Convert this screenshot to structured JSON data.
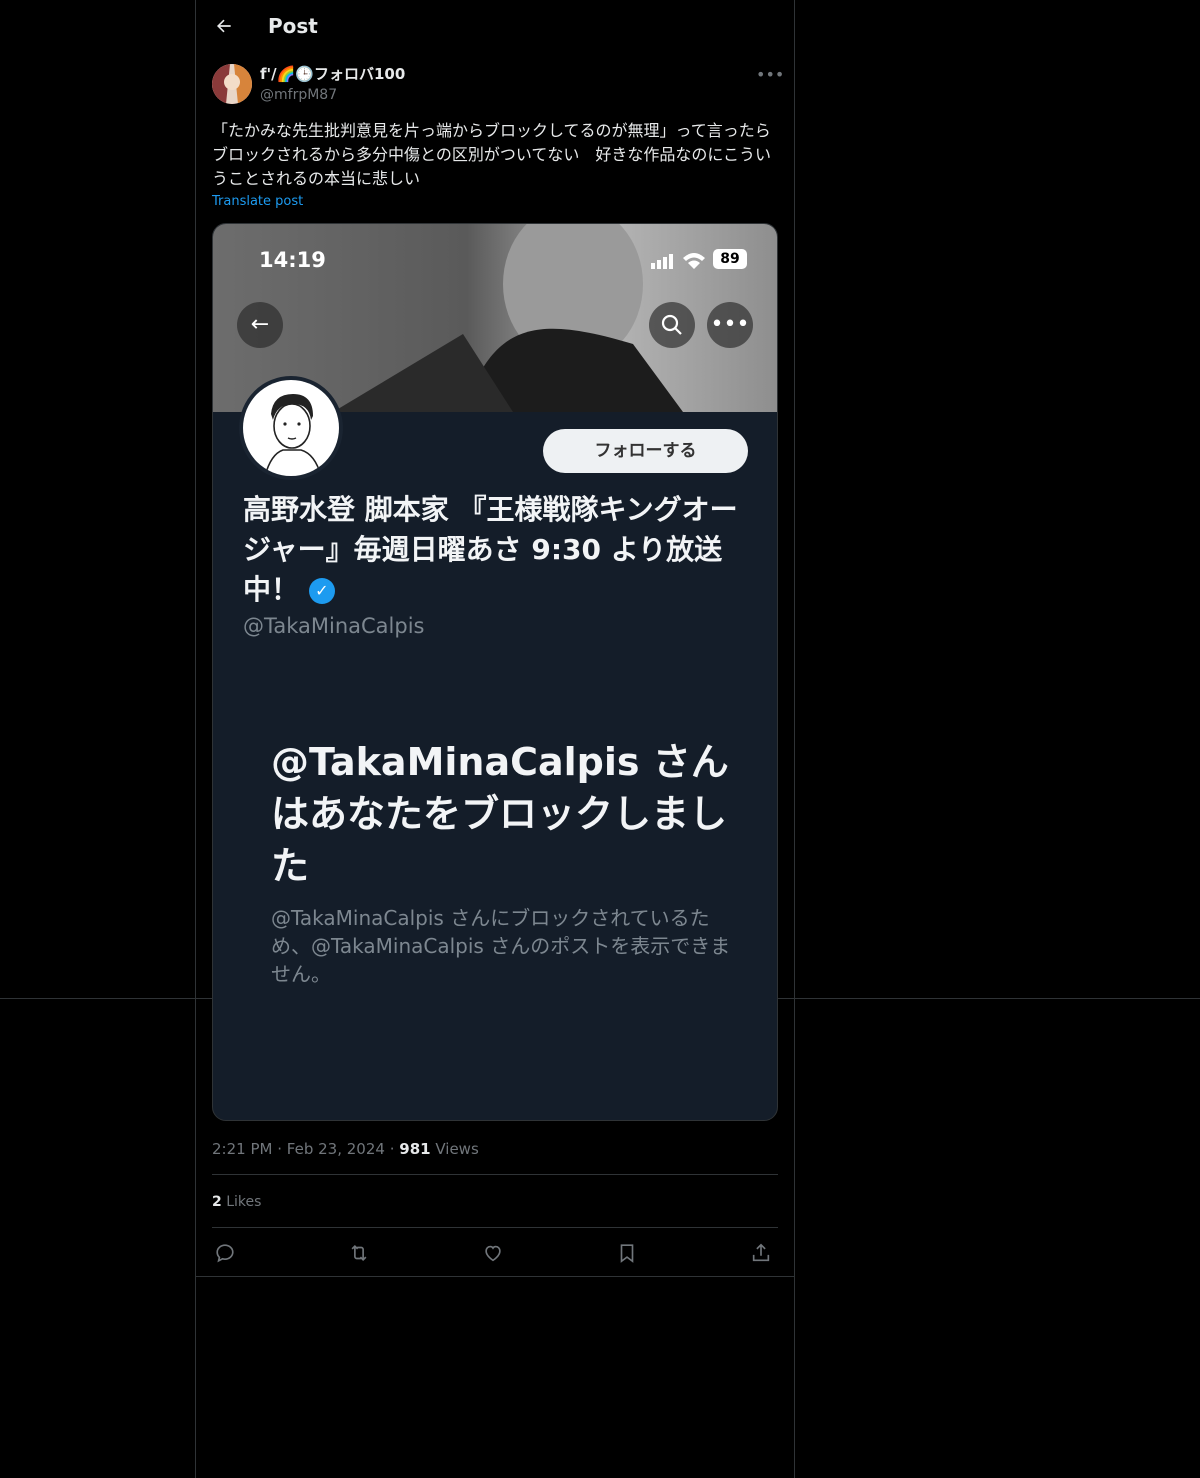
{
  "header": {
    "title": "Post",
    "back_icon": "arrow-left-icon"
  },
  "author": {
    "display_name": "f'/🌈🕒フォロバ100",
    "handle": "@mfrpM87",
    "more_icon": "more-horizontal-icon"
  },
  "post": {
    "text": "「たかみな先生批判意見を片っ端からブロックしてるのが無理」って言ったらブロックされるから多分中傷との区別がついてない　好きな作品なのにこういうことされるの本当に悲しい",
    "translate_label": "Translate post"
  },
  "media": {
    "status_time": "14:19",
    "battery": "89",
    "follow_label": "フォローする",
    "profile_name": "高野水登 脚本家 『王様戦隊キングオージャー』毎週日曜あさ 9:30 より放送中！",
    "verified_icon": "verified-badge-icon",
    "profile_handle": "@TakaMinaCalpis",
    "blocked_title": "@TakaMinaCalpis さんはあなたをブロックしました",
    "blocked_text": "@TakaMinaCalpis さんにブロックされているため、@TakaMinaCalpis さんのポストを表示できません。"
  },
  "meta": {
    "time": "2:21 PM",
    "dot": "·",
    "date": "Feb 23, 2024",
    "views_count": "981",
    "views_label": "Views"
  },
  "stats": {
    "likes_count": "2",
    "likes_label": "Likes"
  },
  "actions": {
    "reply_icon": "reply-icon",
    "repost_icon": "repost-icon",
    "like_icon": "heart-icon",
    "bookmark_icon": "bookmark-icon",
    "share_icon": "share-icon"
  },
  "colors": {
    "accent": "#1d9bf0",
    "background": "#000000",
    "text": "#e7e9ea",
    "muted": "#71767b",
    "border": "#2f3336"
  }
}
